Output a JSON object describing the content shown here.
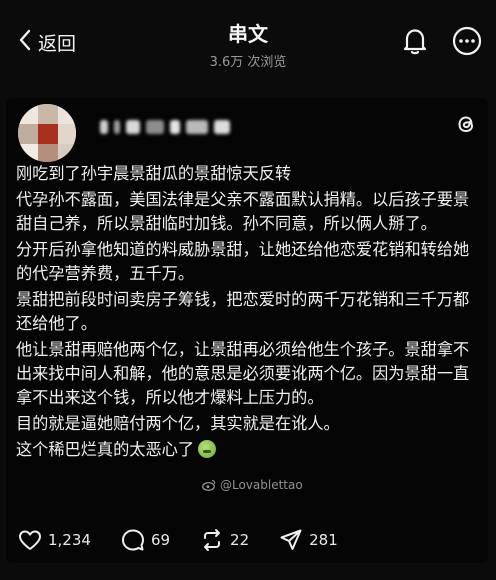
{
  "header": {
    "back_label": "返回",
    "title": "串文",
    "views": "3.6万 次浏览"
  },
  "post": {
    "paragraphs": [
      "刚吃到了孙宇晨景甜瓜的景甜惊天反转",
      "代孕孙不露面，美国法律是父亲不露面默认捐精。以后孩子要景甜自己养，所以景甜临时加钱。孙不同意，所以俩人掰了。",
      "分开后孙拿他知道的料威胁景甜，让她还给他恋爱花销和转给她的代孕营养费，五千万。",
      "景甜把前段时间卖房子筹钱，把恋爱时的两千万花销和三千万都还给他了。",
      "他让景甜再赔他两个亿，让景甜再必须给他生个孩子。景甜拿不出来找中间人和解，他的意思是必须要讹两个亿。因为景甜一直拿不出来这个钱，所以他才爆料上压力的。",
      "目的就是逼她赔付两个亿，其实就是在讹人。",
      "这个稀巴烂真的太恶心了"
    ],
    "watermark": "@Lovablettao",
    "emoji": "nauseated-face-emoji"
  },
  "actions": {
    "likes": "1,234",
    "comments": "69",
    "reposts": "22",
    "shares": "281"
  },
  "colors": {
    "background": "#0b0b0b",
    "text": "#f0f0f0",
    "muted": "#9a9a9a"
  }
}
